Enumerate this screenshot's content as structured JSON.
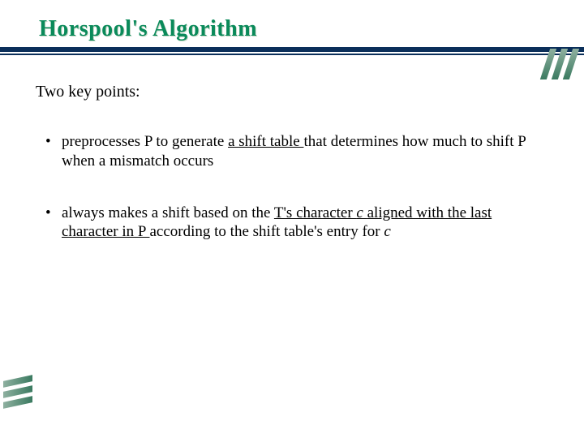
{
  "title": "Horspool's Algorithm",
  "subtitle": "Two key points:",
  "bullets": [
    {
      "pre": "preprocesses P to generate ",
      "u1": "a shift table ",
      "mid": "that determines how much to shift P when a mismatch occurs"
    },
    {
      "pre": "always makes a shift based on the ",
      "u1": "T's character ",
      "ic": "c ",
      "u2": "aligned with the last character in P ",
      "mid": "according to the shift table's entry for ",
      "ic2": "c"
    }
  ]
}
